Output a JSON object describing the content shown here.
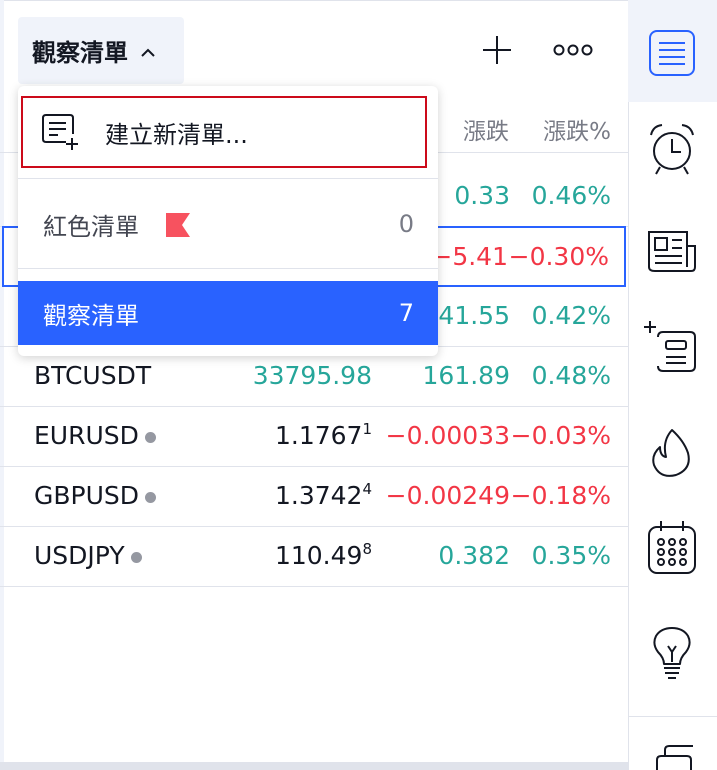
{
  "header": {
    "title": "觀察清單",
    "add_icon": "plus-icon",
    "more_icon": "more-dots-icon"
  },
  "columns": {
    "change": "漲跌",
    "change_pct": "漲跌%"
  },
  "rows": [
    {
      "symbol": "",
      "last": "",
      "last_sup": "",
      "change": "0.33",
      "change_pct": "0.46%",
      "dir": "up"
    },
    {
      "symbol": "",
      "last": "",
      "last_sup": "",
      "change": "−5.41",
      "change_pct": "−0.30%",
      "dir": "down"
    },
    {
      "symbol": "",
      "last": "",
      "last_sup": "",
      "change": "41.55",
      "change_pct": "0.42%",
      "dir": "up"
    },
    {
      "symbol": "BTCUSDT",
      "last": "33795.98",
      "last_sup": "",
      "change": "161.89",
      "change_pct": "0.48%",
      "dir": "up"
    },
    {
      "symbol": "EURUSD",
      "last": "1.1767",
      "last_sup": "1",
      "change": "−0.00033",
      "change_pct": "−0.03%",
      "dir": "down"
    },
    {
      "symbol": "GBPUSD",
      "last": "1.3742",
      "last_sup": "4",
      "change": "−0.00249",
      "change_pct": "−0.18%",
      "dir": "down"
    },
    {
      "symbol": "USDJPY",
      "last": "110.49",
      "last_sup": "8",
      "change": "0.382",
      "change_pct": "0.35%",
      "dir": "up"
    }
  ],
  "dropdown": {
    "new_list": "建立新清單...",
    "lists": [
      {
        "name": "紅色清單",
        "count": "0",
        "flag": true
      },
      {
        "name": "觀察清單",
        "count": "7",
        "active": true
      }
    ]
  },
  "colors": {
    "accent": "#2962ff",
    "up": "#26a69a",
    "down": "#f23645",
    "flag": "#f7525f",
    "highlight_border": "#cc0a1a"
  },
  "right_toolbar": [
    "watchlist-icon",
    "alarm-clock-icon",
    "news-icon",
    "add-list-icon",
    "hotlist-flame-icon",
    "calendar-icon",
    "lightbulb-ideas-icon",
    "chat-icon"
  ]
}
